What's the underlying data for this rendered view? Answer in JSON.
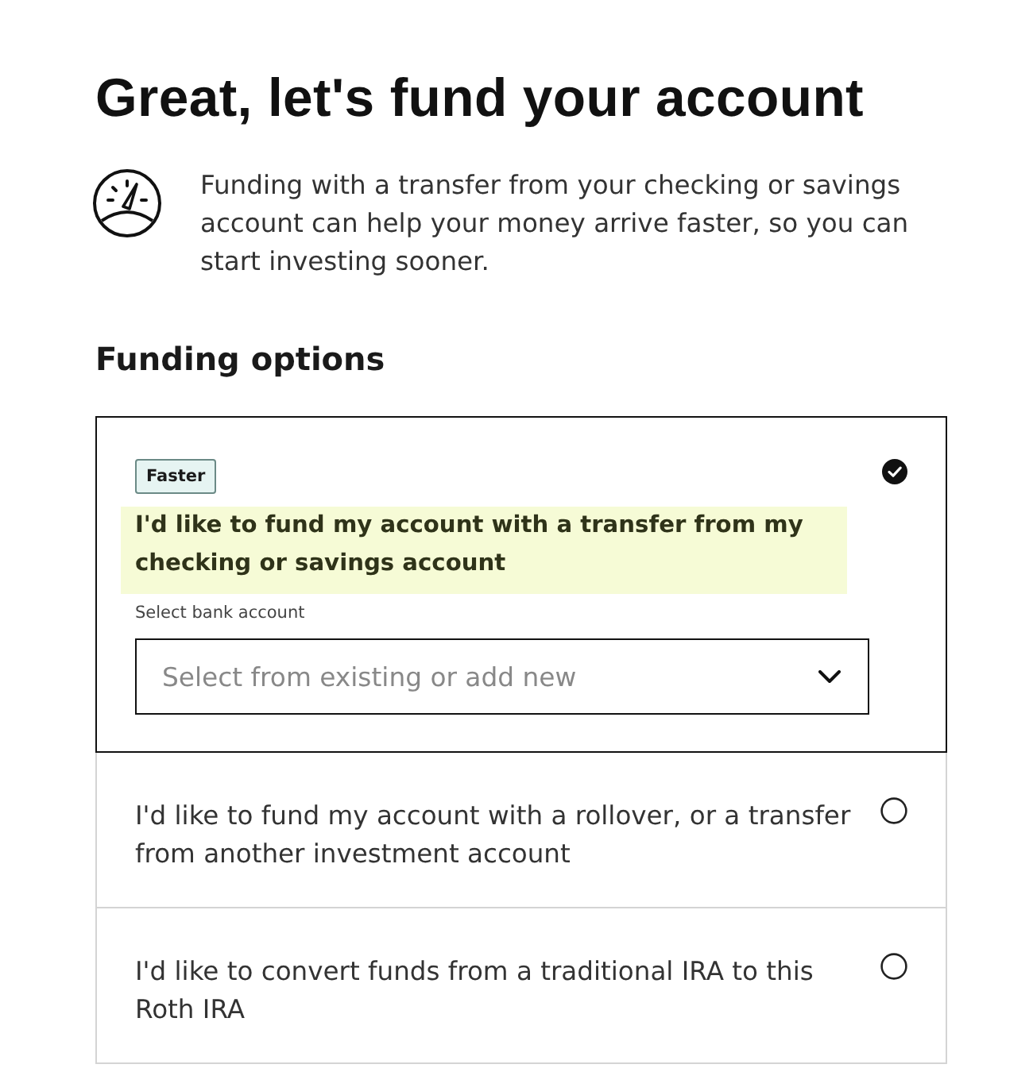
{
  "title": "Great, let's fund your account",
  "intro": {
    "text": "Funding with a transfer from your checking or savings account can help your money arrive faster, so you can start investing sooner."
  },
  "section_heading": "Funding options",
  "options": [
    {
      "badge": "Faster",
      "label": "I'd like to fund my account with a transfer from my checking or savings account",
      "selected": true,
      "highlighted": true,
      "field": {
        "label": "Select bank account",
        "placeholder": "Select from existing or add new"
      }
    },
    {
      "label": "I'd like to fund my account with a rollover, or a transfer from another investment account",
      "selected": false,
      "highlighted": false
    },
    {
      "label": "I'd like to convert funds from a traditional IRA to this Roth IRA",
      "selected": false,
      "highlighted": false
    }
  ]
}
